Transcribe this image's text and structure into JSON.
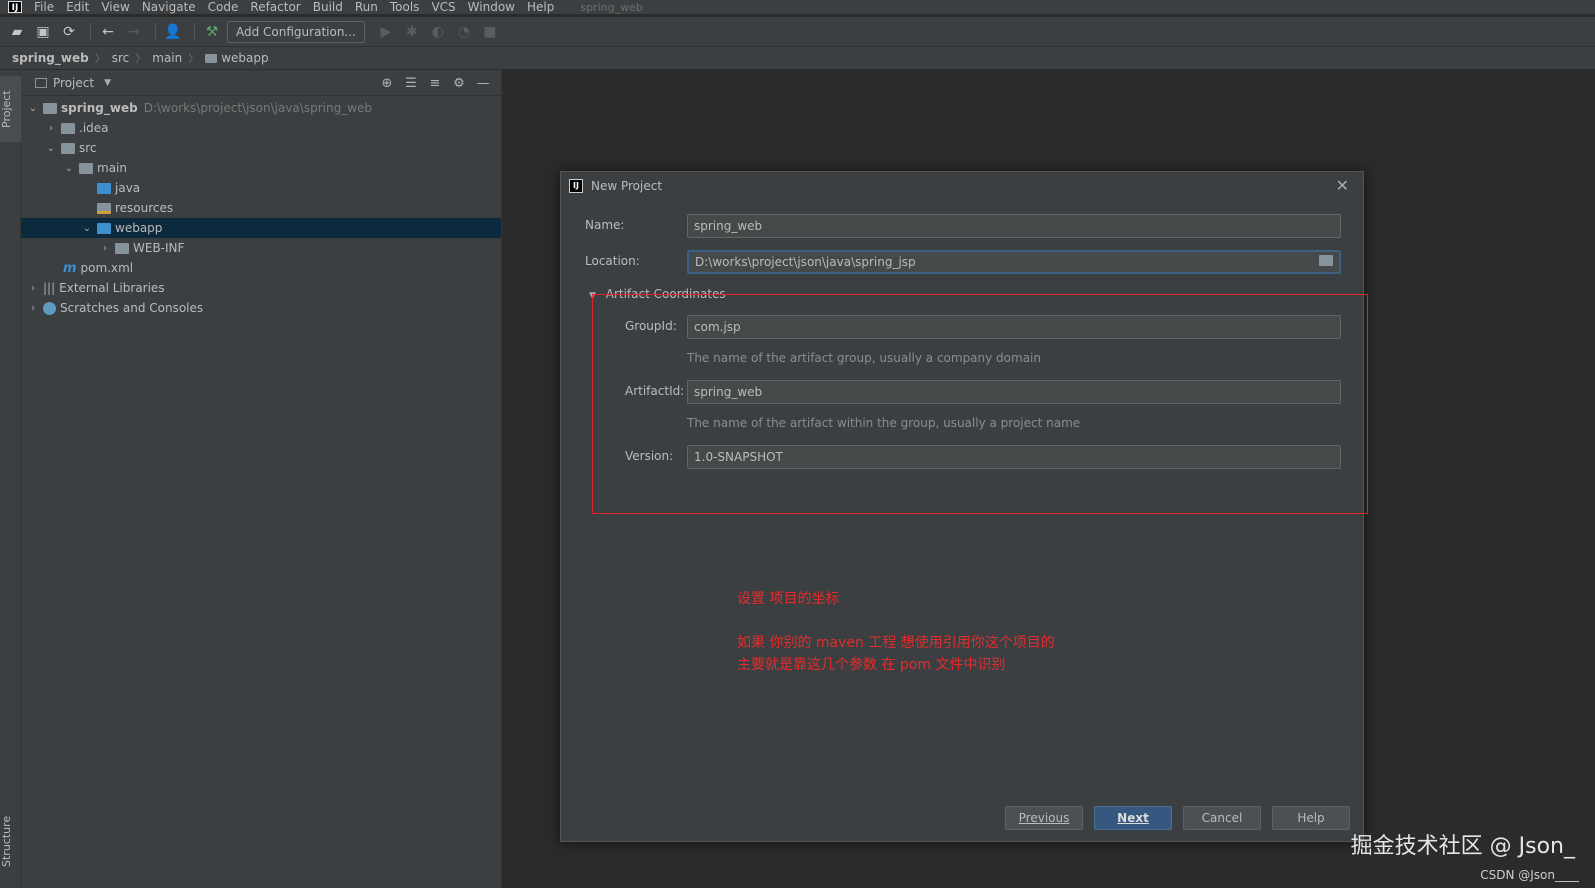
{
  "menubar": {
    "items": [
      "File",
      "Edit",
      "View",
      "Navigate",
      "Code",
      "Refactor",
      "Build",
      "Run",
      "Tools",
      "VCS",
      "Window",
      "Help"
    ],
    "window_title": "spring_web"
  },
  "toolbar": {
    "add_configuration": "Add Configuration..."
  },
  "breadcrumb": [
    "spring_web",
    "src",
    "main",
    "webapp"
  ],
  "tool_strip": {
    "project_tab": "Project",
    "structure_tab": "Structure"
  },
  "project_panel": {
    "title": "Project",
    "tree": [
      {
        "label": "spring_web",
        "path": "D:\\works\\project\\json\\java\\spring_web"
      },
      {
        "label": ".idea"
      },
      {
        "label": "src"
      },
      {
        "label": "main"
      },
      {
        "label": "java"
      },
      {
        "label": "resources"
      },
      {
        "label": "webapp"
      },
      {
        "label": "WEB-INF"
      },
      {
        "label": "pom.xml"
      },
      {
        "label": "External Libraries"
      },
      {
        "label": "Scratches and Consoles"
      }
    ]
  },
  "dialog": {
    "title": "New Project",
    "name_label": "Name:",
    "name_value": "spring_web",
    "location_label": "Location:",
    "location_value": "D:\\works\\project\\json\\java\\spring_jsp",
    "section_title": "Artifact Coordinates",
    "group_label": "GroupId:",
    "group_value": "com.jsp",
    "group_hint": "The name of the artifact group, usually a company domain",
    "artifact_label": "ArtifactId:",
    "artifact_value": "spring_web",
    "artifact_hint": "The name of the artifact within the group, usually a project name",
    "version_label": "Version:",
    "version_value": "1.0-SNAPSHOT",
    "buttons": {
      "previous": "Previous",
      "next": "Next",
      "cancel": "Cancel",
      "help": "Help"
    }
  },
  "annotations": {
    "line1": "设置 项目的坐标",
    "line2": "如果 你别的 maven  工程 想使用引用你这个项目的",
    "line3": "主要就是靠这几个参数  在 pom 文件中识别"
  },
  "watermark": {
    "main": "掘金技术社区 @ Json_",
    "sub": "CSDN @Json____"
  }
}
